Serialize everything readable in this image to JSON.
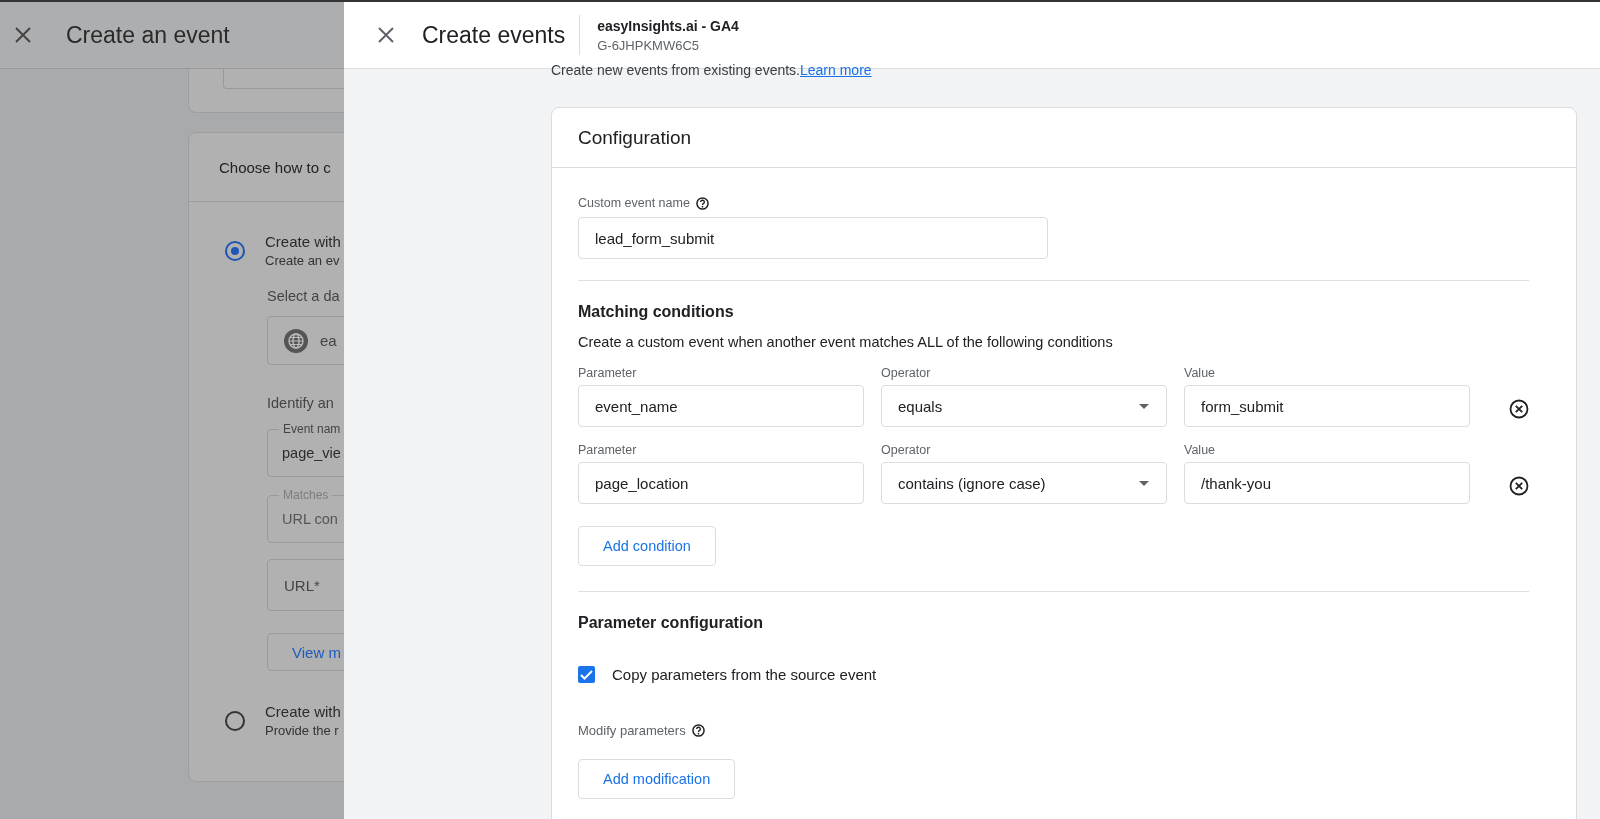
{
  "background_dialog": {
    "title": "Create an event",
    "card_title": "Choose how to c",
    "options": [
      {
        "label": "Create with",
        "description": "Create an ev",
        "selected": true
      },
      {
        "label": "Create with",
        "description": "Provide the r",
        "selected": false
      }
    ],
    "data_stream_label": "Select a da",
    "data_stream_value": "ea",
    "identify_label": "Identify an",
    "event_name_field": {
      "label": "Event nam",
      "value": "page_vie",
      "disabled": false
    },
    "matches_field": {
      "label": "Matches",
      "value": "URL con",
      "disabled": true
    },
    "url_field": {
      "placeholder": "URL*"
    },
    "view_button": "View m"
  },
  "dialog": {
    "title": "Create events",
    "account": "easyInsights.ai - GA4",
    "property_id": "G-6JHPKMW6C5",
    "intro": "Create new events from existing events.",
    "learn_more": "Learn more"
  },
  "configuration": {
    "title": "Configuration",
    "custom_event_name": {
      "label": "Custom event name",
      "value": "lead_form_submit"
    },
    "matching": {
      "title": "Matching conditions",
      "description": "Create a custom event when another event matches ALL of the following conditions",
      "conditions": [
        {
          "parameter_label": "Parameter",
          "parameter": "event_name",
          "operator_label": "Operator",
          "operator": "equals",
          "value_label": "Value",
          "value": "form_submit"
        },
        {
          "parameter_label": "Parameter",
          "parameter": "page_location",
          "operator_label": "Operator",
          "operator": "contains (ignore case)",
          "value_label": "Value",
          "value": "/thank-you"
        }
      ],
      "add_button": "Add condition"
    },
    "parameter_configuration": {
      "title": "Parameter configuration",
      "copy": {
        "label": "Copy parameters from the source event",
        "checked": true
      },
      "modify_label": "Modify parameters",
      "add_button": "Add modification"
    }
  }
}
